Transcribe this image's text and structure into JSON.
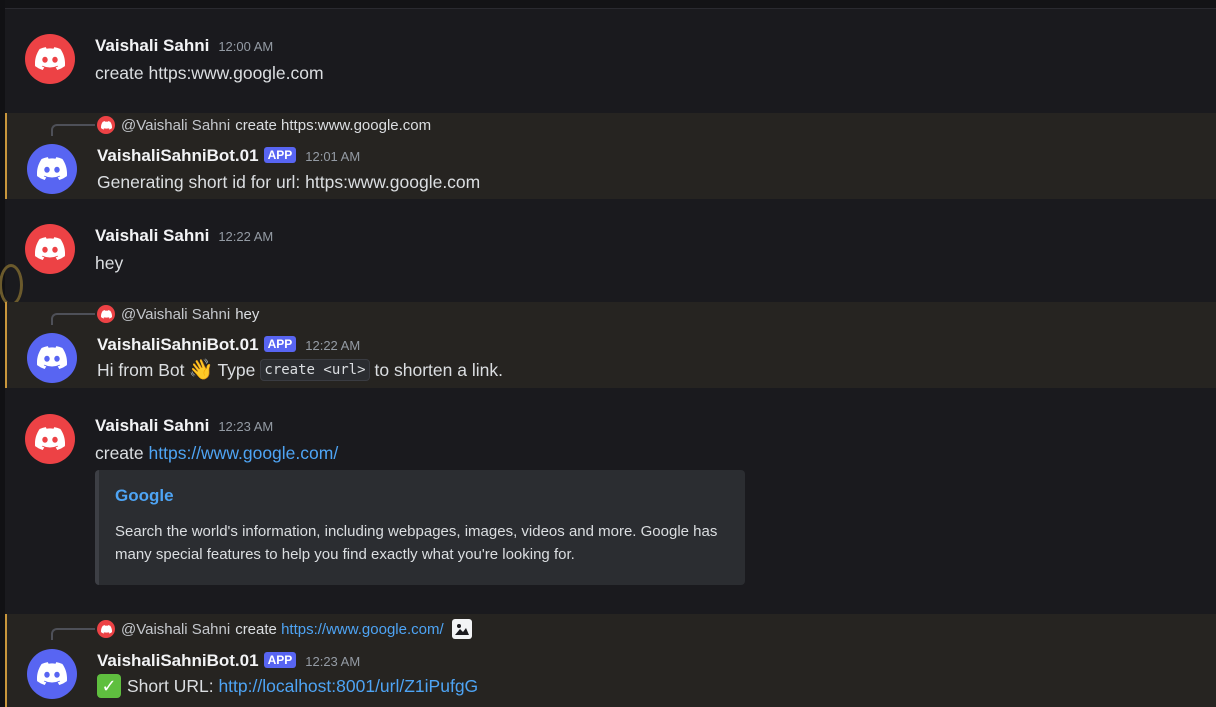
{
  "messages": [
    {
      "user": "Vaishali Sahni",
      "time": "12:00 AM",
      "text": "create https:www.google.com"
    },
    {
      "reply": {
        "user": "@Vaishali Sahni",
        "text": "create https:www.google.com"
      },
      "user": "VaishaliSahniBot.01",
      "tag": "APP",
      "time": "12:01 AM",
      "text": "Generating short id for url: https:www.google.com"
    },
    {
      "user": "Vaishali Sahni",
      "time": "12:22 AM",
      "text": "hey"
    },
    {
      "reply": {
        "user": "@Vaishali Sahni",
        "text": "hey"
      },
      "user": "VaishaliSahniBot.01",
      "tag": "APP",
      "time": "12:22 AM",
      "text_a": "Hi from Bot",
      "emoji": "👋",
      "text_b": "Type",
      "code": "create <url>",
      "text_c": "to shorten a link."
    },
    {
      "user": "Vaishali Sahni",
      "time": "12:23 AM",
      "text_prefix": "create",
      "link": "https://www.google.com/",
      "embed": {
        "title": "Google",
        "description": "Search the world's information, including webpages, images, videos and more. Google has many special features to help you find exactly what you're looking for."
      }
    },
    {
      "reply": {
        "user": "@Vaishali Sahni",
        "text": "create",
        "link": "https://www.google.com/"
      },
      "user": "VaishaliSahniBot.01",
      "tag": "APP",
      "time": "12:23 AM",
      "text_prefix": "Short URL:",
      "check_icon": "check-mark-button",
      "link": "http://localhost:8001/url/Z1iPufgG"
    }
  ],
  "colors": {
    "background": "#1a1a1e",
    "mention_bg": "#262421",
    "mention_bar": "#c8963c",
    "link": "#4ea4f4",
    "app_tag": "#5865f2",
    "user_avatar": "#ed4245",
    "bot_avatar": "#5865f2"
  }
}
